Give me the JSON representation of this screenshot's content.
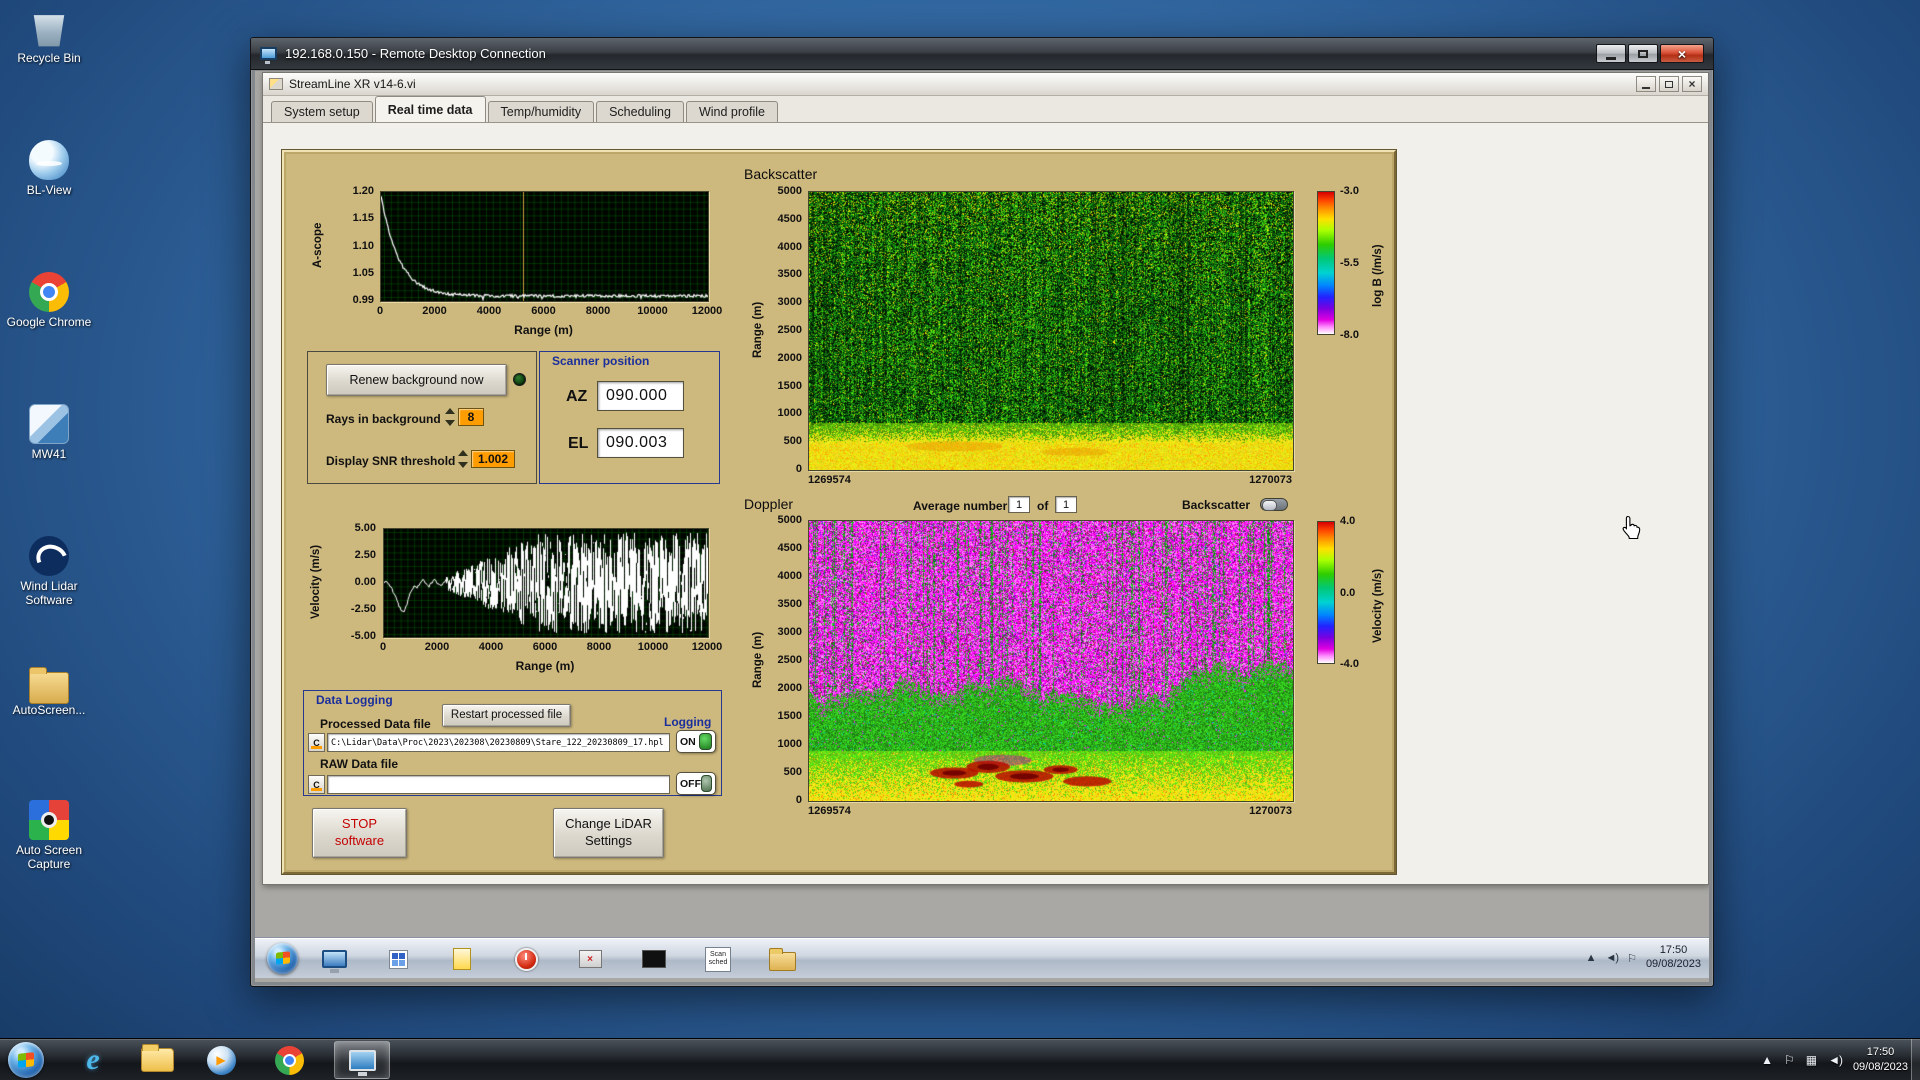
{
  "desktop": {
    "icons": [
      {
        "name": "recycle-bin",
        "label": "Recycle Bin"
      },
      {
        "name": "bl-view",
        "label": "BL-View"
      },
      {
        "name": "google-chrome",
        "label": "Google Chrome"
      },
      {
        "name": "mw41",
        "label": "MW41"
      },
      {
        "name": "wind-lidar-software",
        "label": "Wind Lidar Software"
      },
      {
        "name": "autoscreen",
        "label": "AutoScreen..."
      },
      {
        "name": "auto-screen-capture",
        "label": "Auto Screen Capture"
      }
    ]
  },
  "rdp_window": {
    "title": "192.168.0.150 - Remote Desktop Connection"
  },
  "app_window": {
    "title": "StreamLine XR v14-6.vi",
    "tabs": [
      "System setup",
      "Real time data",
      "Temp/humidity",
      "Scheduling",
      "Wind profile"
    ],
    "active_tab": "Real time data"
  },
  "ascope": {
    "ylabel": "A-scope",
    "yticks": [
      "1.20",
      "1.15",
      "1.10",
      "1.05",
      "0.99"
    ],
    "xticks": [
      "0",
      "2000",
      "4000",
      "6000",
      "8000",
      "10000",
      "12000"
    ],
    "xlabel": "Range (m)"
  },
  "background_controls": {
    "renew_button": "Renew background now",
    "rays_label": "Rays in background",
    "rays_value": "8",
    "snr_label": "Display SNR threshold",
    "snr_value": "1.002"
  },
  "scanner": {
    "title": "Scanner position",
    "az_label": "AZ",
    "az_value": "090.000",
    "el_label": "EL",
    "el_value": "090.003"
  },
  "backscatter": {
    "title": "Backscatter",
    "ylabel": "Range (m)",
    "yticks": [
      "5000",
      "4500",
      "4000",
      "3500",
      "3000",
      "2500",
      "2000",
      "1500",
      "1000",
      "500",
      "0"
    ],
    "x_start": "1269574",
    "x_end": "1270073",
    "colorbar_ticks": [
      "-3.0",
      "-5.5",
      "-8.0"
    ],
    "colorbar_label": "log B (/m/s)"
  },
  "doppler": {
    "title": "Doppler",
    "avg_label": "Average number",
    "avg_value": "1",
    "of_label": "of",
    "of_value": "1",
    "toggle_label": "Backscatter",
    "ylabel": "Range (m)",
    "yticks": [
      "5000",
      "4500",
      "4000",
      "3500",
      "3000",
      "2500",
      "2000",
      "1500",
      "1000",
      "500",
      "0"
    ],
    "x_start": "1269574",
    "x_end": "1270073",
    "colorbar_ticks": [
      "4.0",
      "0.0",
      "-4.0"
    ],
    "colorbar_label": "Velocity (m/s)"
  },
  "velocity": {
    "ylabel": "Velocity (m/s)",
    "yticks": [
      "5.00",
      "2.50",
      "0.00",
      "-2.50",
      "-5.00"
    ],
    "xticks": [
      "0",
      "2000",
      "4000",
      "6000",
      "8000",
      "10000",
      "12000"
    ],
    "xlabel": "Range (m)"
  },
  "logging": {
    "title": "Data Logging",
    "processed_label": "Processed Data file",
    "restart_button": "Restart processed file",
    "logging_label": "Logging",
    "drive_letter": "C",
    "processed_path": "C:\\Lidar\\Data\\Proc\\2023\\202308\\20230809\\Stare_122_20230809_17.hpl",
    "on_label": "ON",
    "raw_label": "RAW Data file",
    "raw_path": "",
    "off_label": "OFF"
  },
  "actions": {
    "stop_button": "STOP\nsoftware",
    "settings_button": "Change LiDAR\nSettings"
  },
  "remote_taskbar": {
    "scan_icon_text": "Scan sched",
    "time": "17:50",
    "date": "09/08/2023"
  },
  "host_taskbar": {
    "ie_glyph": "e",
    "time": "17:50",
    "date": "09/08/2023"
  }
}
